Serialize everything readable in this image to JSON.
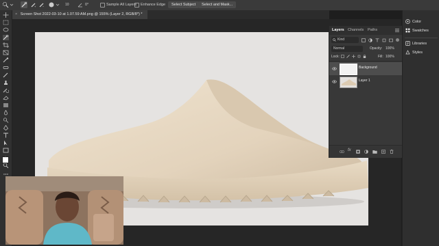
{
  "options_bar": {
    "size_value": "10",
    "angle_value": "0°",
    "sample_all_layers_label": "Sample All Layers",
    "enhance_edge_label": "Enhance Edge",
    "select_subject_label": "Select Subject",
    "select_and_mask_label": "Select and Mask..."
  },
  "document": {
    "tab_title": "Screen Shot 2022-03-10 at 1.07.59 AM.png @ 155% (Layer 2, RGB/8*) *"
  },
  "layers_panel": {
    "tabs": [
      "Layers",
      "Channels",
      "Paths"
    ],
    "active_tab": "Layers",
    "filter_kind": "Kind",
    "blend_mode": "Normal",
    "opacity_label": "Opacity:",
    "opacity_value": "100%",
    "lock_label": "Lock:",
    "fill_label": "Fill:",
    "fill_value": "100%",
    "layers": [
      {
        "name": "Background",
        "selected": true
      },
      {
        "name": "Layer 1",
        "selected": false
      }
    ]
  },
  "right_dock": {
    "items": [
      "Color",
      "Swatches",
      "Libraries",
      "Styles"
    ]
  },
  "colors": {
    "accent": "#5b8dd6",
    "panel_bg": "#383838",
    "canvas_bg": "#262626",
    "photo_bg": "#e5e3e1",
    "slide_color": "#e8d9c3"
  }
}
